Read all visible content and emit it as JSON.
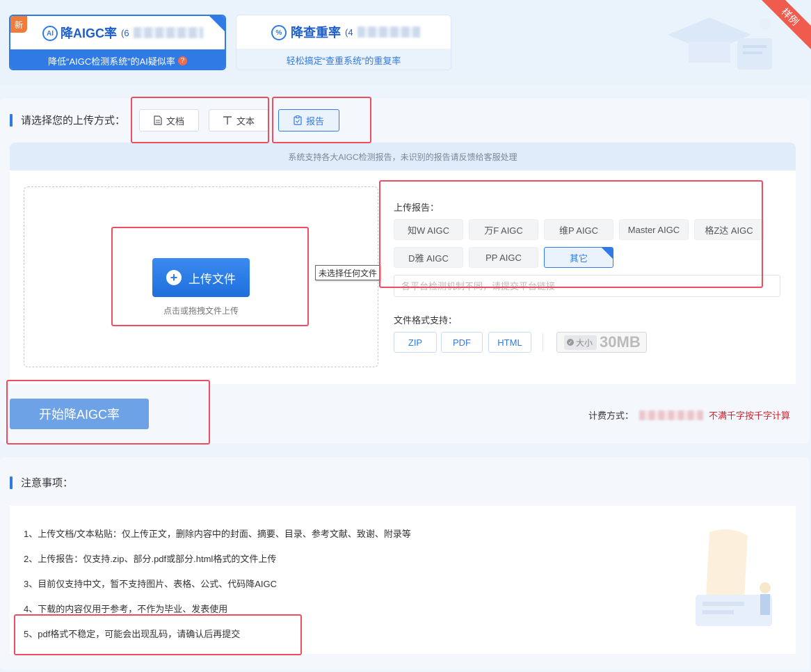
{
  "mode_tabs": {
    "aigc": {
      "badge": "新",
      "icon_text": "AI",
      "title": "降AIGC率",
      "prefix": "(6",
      "subtitle": "降低“AIGC检测系统”的AI疑似率",
      "help": "?"
    },
    "duplicate": {
      "title": "降查重率",
      "prefix": "(4",
      "subtitle": "轻松搞定“查重系统”的重复率"
    },
    "ribbon": "样例"
  },
  "upload_method": {
    "label": "请选择您的上传方式：",
    "options": [
      {
        "label": "文档",
        "icon": "document-icon"
      },
      {
        "label": "文本",
        "icon": "text-icon"
      },
      {
        "label": "报告",
        "icon": "report-icon"
      }
    ],
    "selected": "报告"
  },
  "info_strip": "系统支持各大AIGC检测报告，未识别的报告请反馈给客服处理",
  "upload": {
    "button_label": "上传文件",
    "hint": "点击或拖拽文件上传",
    "tooltip": "未选择任何文件"
  },
  "report": {
    "label": "上传报告：",
    "platforms": [
      "知W AIGC",
      "万F AIGC",
      "维P AIGC",
      "Master AIGC",
      "格Z达 AIGC",
      "D雅 AIGC",
      "PP AIGC",
      "其它"
    ],
    "selected": "其它",
    "link_placeholder": "各平台检测机制不同，请提交平台链接"
  },
  "formats": {
    "label": "文件格式支持：",
    "items": [
      "ZIP",
      "PDF",
      "HTML"
    ],
    "size_label": "大小",
    "size_value": "30MB"
  },
  "actions": {
    "start_label": "开始降AIGC率",
    "billing_label": "计费方式：",
    "billing_note": "不满千字按千字计算"
  },
  "notes": {
    "title": "注意事项：",
    "items": [
      "1、上传文档/文本粘贴：仅上传正文，删除内容中的封面、摘要、目录、参考文献、致谢、附录等",
      "2、上传报告：仅支持.zip、部分.pdf或部分.html格式的文件上传",
      "3、目前仅支持中文，暂不支持图片、表格、公式、代码降AIGC",
      "4、下载的内容仅用于参考，不作为毕业、发表使用",
      "5、pdf格式不稳定，可能会出现乱码，请确认后再提交"
    ]
  },
  "colors": {
    "accent": "#2f7ae5",
    "highlight_box": "#ee4d5f",
    "start_button": "#6ea2e6",
    "warning_text": "#d6232d"
  }
}
